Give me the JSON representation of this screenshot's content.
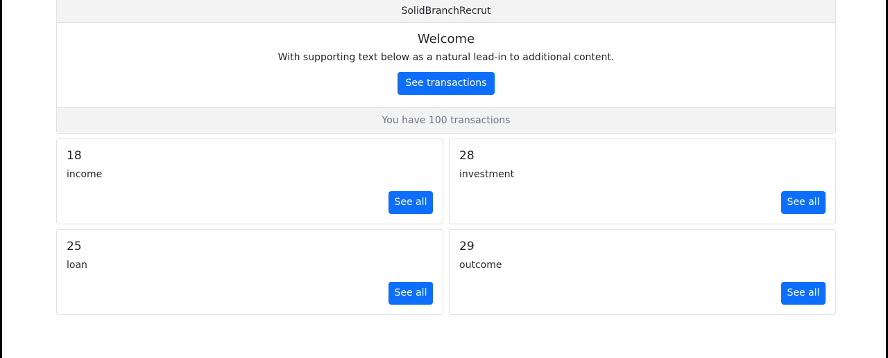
{
  "app": {
    "title": "SolidBranchRecrut"
  },
  "welcome": {
    "title": "Welcome",
    "text": "With supporting text below as a natural lead-in to additional content.",
    "button_label": "See transactions",
    "footer_text": "You have 100 transactions"
  },
  "categories": [
    {
      "count": "18",
      "label": "income",
      "button_label": "See all"
    },
    {
      "count": "28",
      "label": "investment",
      "button_label": "See all"
    },
    {
      "count": "25",
      "label": "loan",
      "button_label": "See all"
    },
    {
      "count": "29",
      "label": "outcome",
      "button_label": "See all"
    }
  ],
  "colors": {
    "primary": "#0d6efd",
    "header_bg": "#f3f3f3",
    "border": "#dee2e6",
    "muted_text": "#6c757d"
  }
}
